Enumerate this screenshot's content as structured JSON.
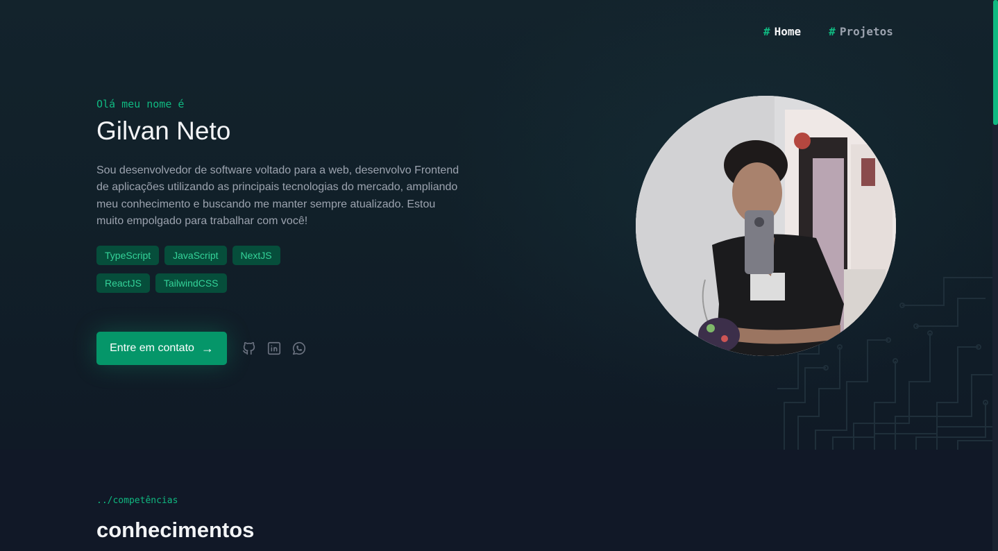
{
  "nav": {
    "items": [
      {
        "hash": "#",
        "label": "Home"
      },
      {
        "hash": "#",
        "label": "Projetos"
      }
    ]
  },
  "hero": {
    "greeting": "Olá meu nome é",
    "name": "Gilvan Neto",
    "bio": "Sou desenvolvedor de software voltado para a web, desenvolvo Frontend de aplicações utilizando as principais tecnologias do mercado, ampliando meu conhecimento e buscando me manter sempre atualizado. Estou muito empolgado para trabalhar com você!",
    "tags": [
      "TypeScript",
      "JavaScript",
      "NextJS",
      "ReactJS",
      "TailwindCSS"
    ],
    "cta": {
      "label": "Entre em contato",
      "arrow": "→"
    },
    "socials": [
      {
        "icon": "github-icon"
      },
      {
        "icon": "linkedin-icon"
      },
      {
        "icon": "whatsapp-icon"
      }
    ]
  },
  "section": {
    "subtitle": "../competências",
    "title": "conhecimentos"
  },
  "colors": {
    "accent": "#10b981",
    "background": "#111827",
    "tag_bg": "#064e3b",
    "button": "#059669"
  }
}
